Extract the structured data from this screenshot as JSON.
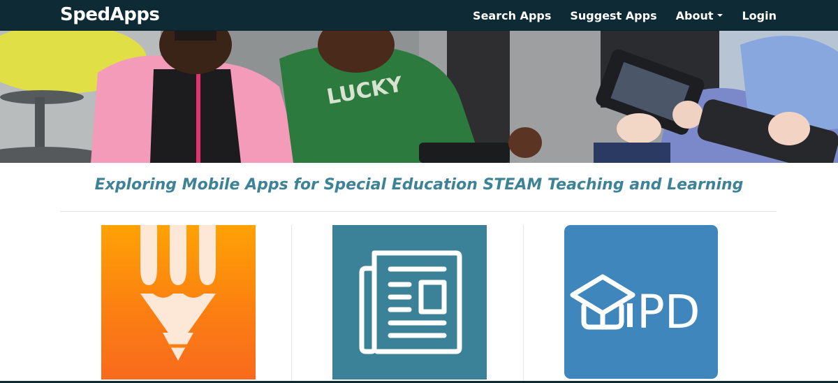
{
  "navbar": {
    "brand": "SpedApps",
    "links": {
      "search_apps": "Search Apps",
      "suggest_apps": "Suggest Apps",
      "about": "About",
      "login": "Login"
    },
    "background_color": "#0d2a35"
  },
  "hero": {
    "image_description_icon": "children-using-tablets-photo"
  },
  "main": {
    "tagline": "Exploring Mobile Apps for Special Education STEAM Teaching and Learning",
    "tagline_color": "#3d8296"
  },
  "apps": [
    {
      "icon": "pencil-app-icon",
      "color": "#fb8a0f"
    },
    {
      "icon": "newspaper-app-icon",
      "color": "#3b8197"
    },
    {
      "icon": "ipd-app-icon",
      "label": "iPD",
      "color": "#3f86bd"
    }
  ]
}
